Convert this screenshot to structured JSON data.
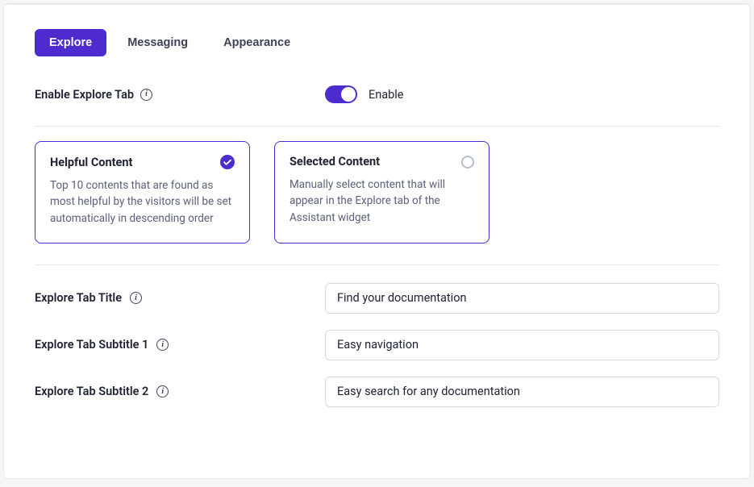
{
  "tabs": {
    "explore": "Explore",
    "messaging": "Messaging",
    "appearance": "Appearance"
  },
  "enable_section": {
    "label": "Enable Explore Tab",
    "toggle_text": "Enable"
  },
  "options": {
    "helpful": {
      "title": "Helpful Content",
      "desc": "Top 10 contents that are found as most helpful by the visitors will be set automatically in descending order"
    },
    "selected": {
      "title": "Selected Content",
      "desc": "Manually select content that will appear in the Explore tab of the Assistant widget"
    }
  },
  "fields": {
    "title_label": "Explore Tab Title",
    "title_value": "Find your documentation",
    "sub1_label": "Explore Tab Subtitle 1",
    "sub1_value": "Easy navigation",
    "sub2_label": "Explore Tab Subtitle 2",
    "sub2_value": "Easy search for any documentation"
  }
}
